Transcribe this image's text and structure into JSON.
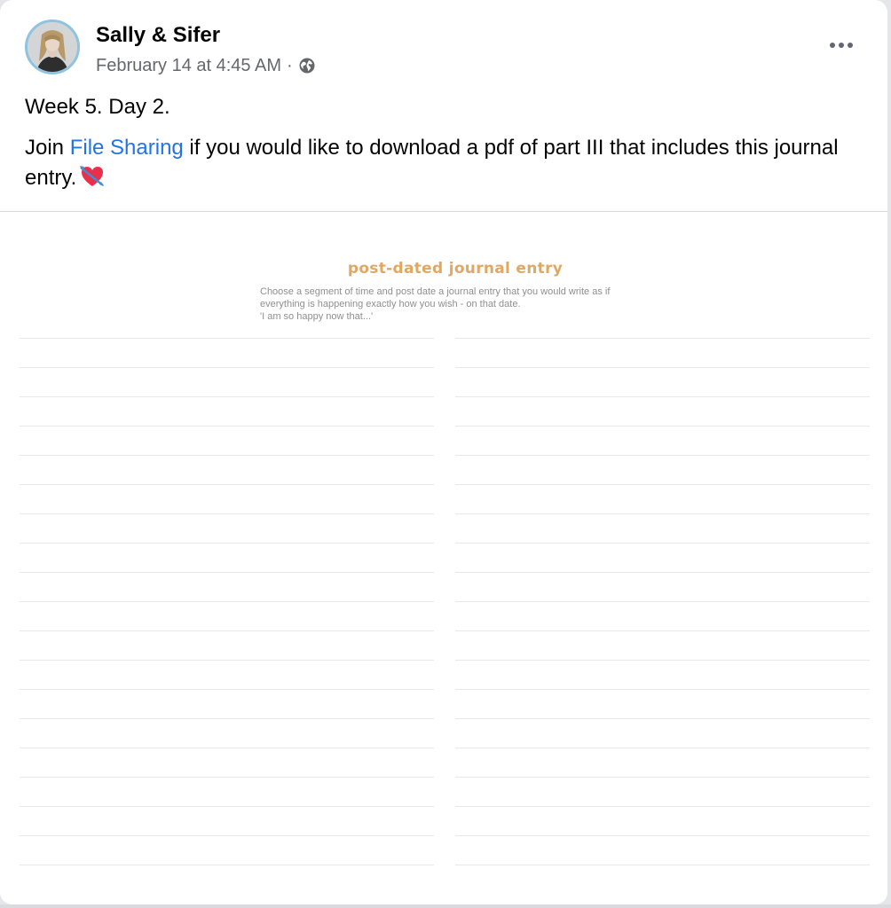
{
  "post": {
    "author": "Sally & Sifer",
    "timestamp": "February 14 at 4:45 AM",
    "separator": "·",
    "audience_icon": "globe-icon",
    "more_icon": "more-options-icon",
    "text": {
      "line1": "Week 5. Day 2.",
      "line2_prefix": "Join ",
      "line2_link": "File Sharing",
      "line2_suffix": " if you would like to download a pdf of part III that includes this journal entry.",
      "emoji": "heart-with-arrow-icon"
    }
  },
  "attachment": {
    "title": "post-dated journal entry",
    "instructions": [
      "Choose a segment of time and post date a journal entry that you would write as if",
      "everything is happening exactly how you wish - on that date.",
      "'I am so happy now that...'"
    ],
    "title_color": "#e0a862"
  },
  "colors": {
    "link": "#2374e1",
    "meta": "#65676b",
    "avatar_ring": "#8fc3df"
  }
}
